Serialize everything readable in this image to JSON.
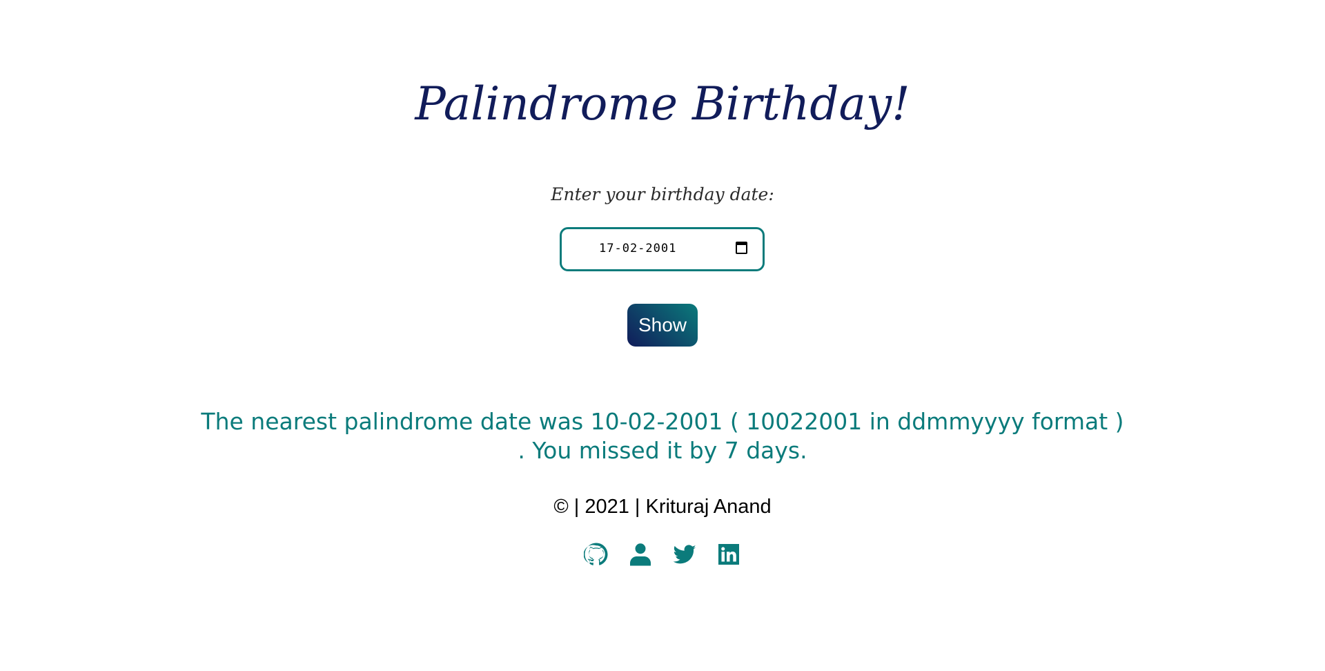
{
  "header": {
    "title": "Palindrome Birthday!"
  },
  "form": {
    "label": "Enter your birthday date:",
    "date_value": "17-02-2001",
    "show_label": "Show"
  },
  "result": {
    "line1": "The nearest palindrome date was 10-02-2001 ( 10022001 in ddmmyyyy format )",
    "line2": ". You missed it by 7 days."
  },
  "footer": {
    "copyright": "© | 2021 | Krituraj Anand",
    "icons": [
      "github-icon",
      "user-icon",
      "twitter-icon",
      "linkedin-icon"
    ]
  },
  "colors": {
    "primary": "#111c5a",
    "accent": "#0b7b7b"
  }
}
